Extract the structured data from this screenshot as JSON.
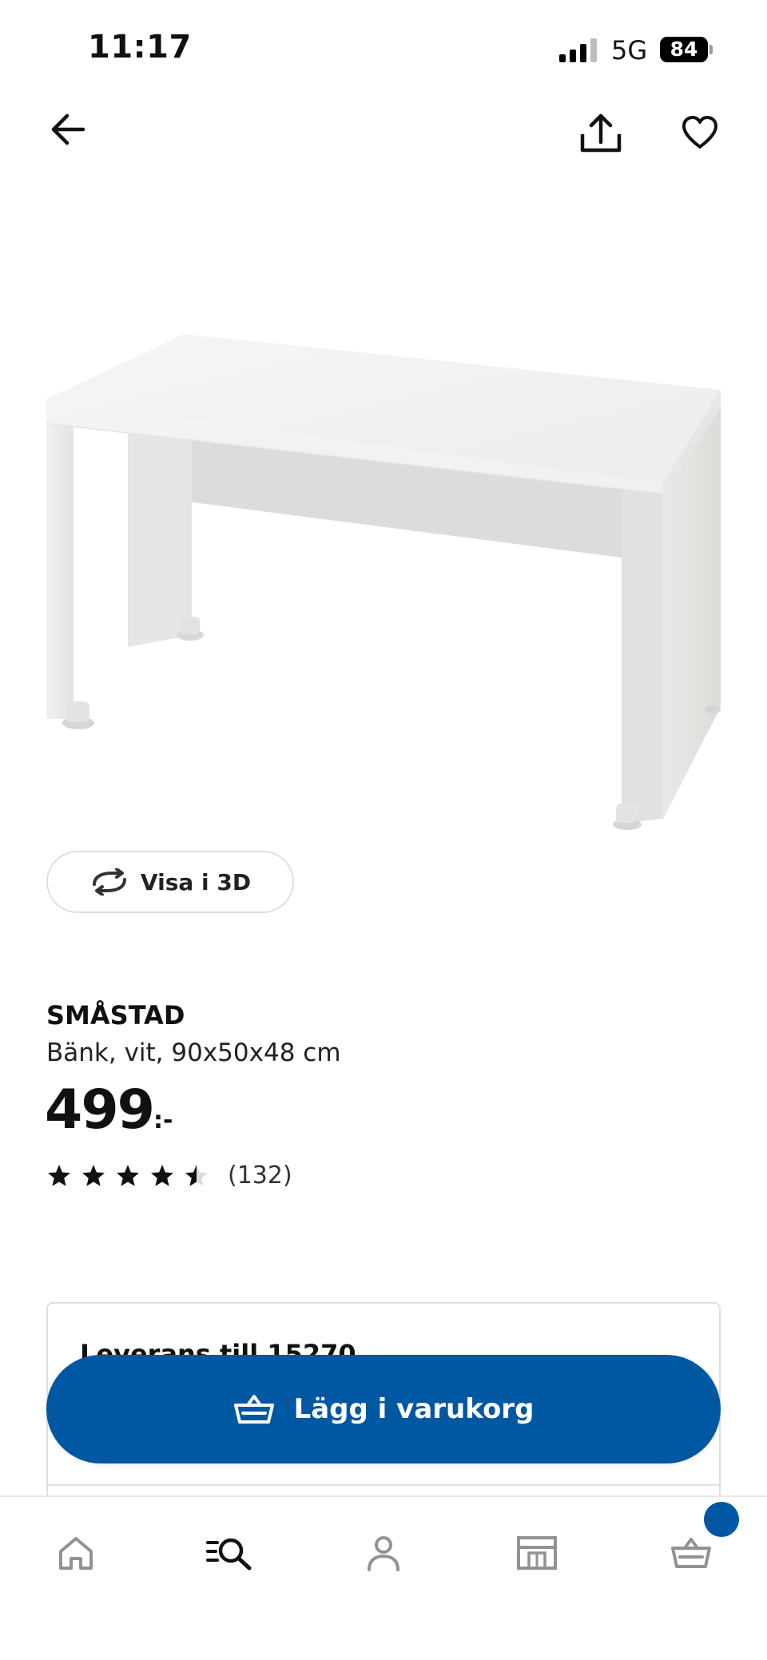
{
  "status_bar": {
    "time": "11:17",
    "network": "5G",
    "battery": "84"
  },
  "top_bar": {
    "back_icon": "arrow-left-icon",
    "share_icon": "share-icon",
    "favorite_icon": "heart-icon"
  },
  "view3d": {
    "label": "Visa i 3D",
    "icon": "rotate-3d-icon"
  },
  "product": {
    "name": "SMÅSTAD",
    "description": "Bänk, vit, 90x50x48 cm",
    "price": "499",
    "price_suffix": ":-",
    "rating": 4.5,
    "rating_max": 5,
    "review_count": "(132)"
  },
  "delivery": {
    "title": "Leverans till 15270"
  },
  "cta": {
    "label": "Lägg i varukorg",
    "icon": "basket-icon"
  },
  "bottom_nav": {
    "tabs": [
      {
        "name": "home",
        "icon": "home-icon",
        "active": false
      },
      {
        "name": "search",
        "icon": "search-icon",
        "active": true
      },
      {
        "name": "profile",
        "icon": "person-icon",
        "active": false
      },
      {
        "name": "stores",
        "icon": "store-icon",
        "active": false
      },
      {
        "name": "cart",
        "icon": "basket-icon",
        "active": false
      }
    ]
  },
  "colors": {
    "primary": "#0058a3",
    "text": "#111111",
    "inactive_icon": "#929292",
    "border": "#dfdfdf"
  }
}
